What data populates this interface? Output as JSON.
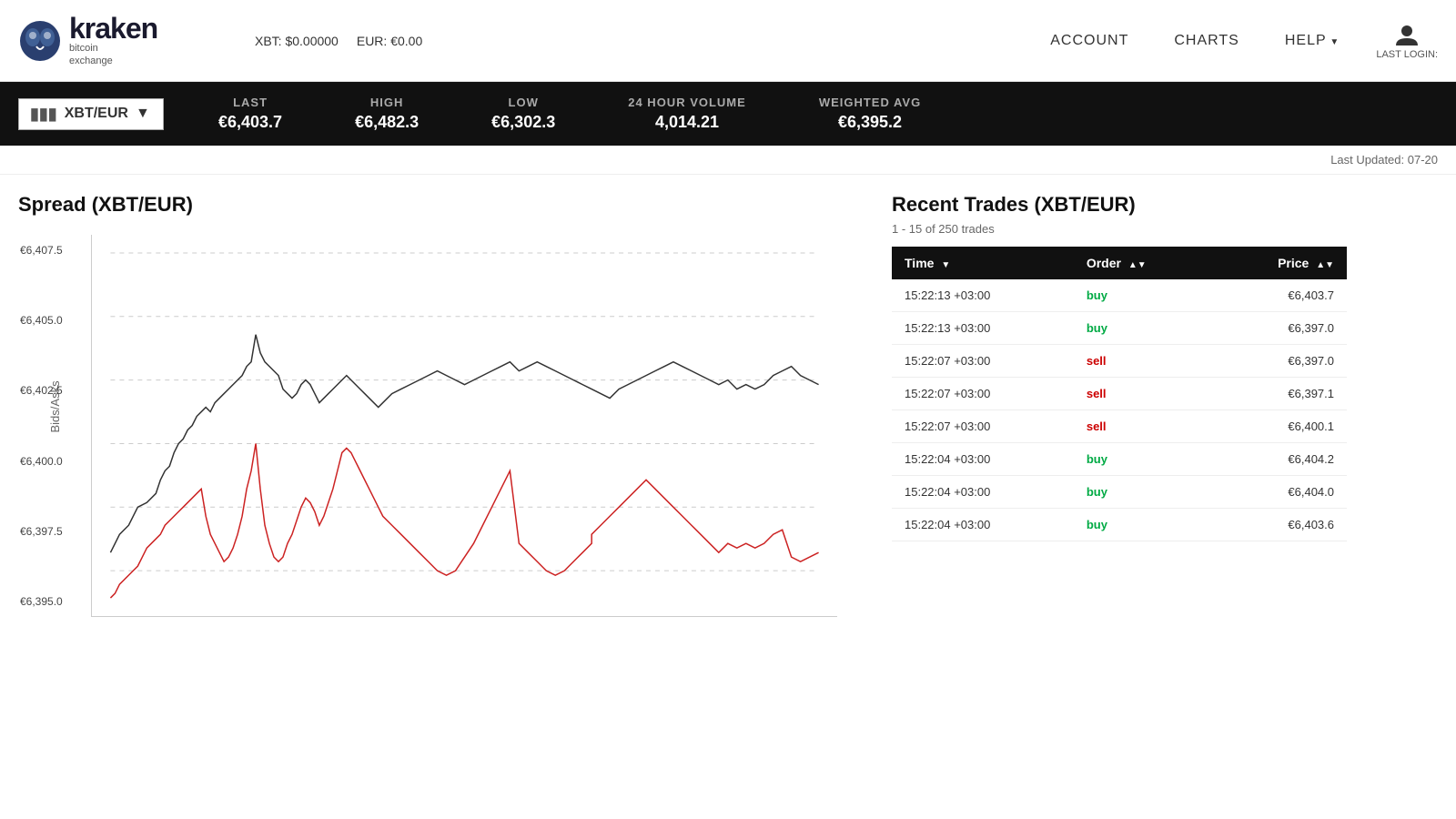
{
  "header": {
    "logo_name": "kraken",
    "logo_sub_line1": "bitcoin",
    "logo_sub_line2": "exchange",
    "xbt_balance": "XBT: $0.00000",
    "eur_balance": "EUR: €0.00",
    "nav_account": "ACCOUNT",
    "nav_charts": "CHARTS",
    "nav_help": "HELP",
    "user_label": "LAST LOGIN:"
  },
  "ticker": {
    "pair": "XBT/EUR",
    "last_label": "LAST",
    "last_value": "€6,403.7",
    "high_label": "HIGH",
    "high_value": "€6,482.3",
    "low_label": "LOW",
    "low_value": "€6,302.3",
    "volume_label": "24 HOUR VOLUME",
    "volume_value": "4,014.21",
    "wavg_label": "WEIGHTED AVG",
    "wavg_value": "€6,395.2"
  },
  "last_updated": "Last Updated: 07-20",
  "chart": {
    "title": "Spread (XBT/EUR)",
    "y_axis_label": "Bids/Asks",
    "y_ticks": [
      "€6,407.5",
      "€6,405.0",
      "€6,402.5",
      "€6,400.0",
      "€6,397.5",
      "€6,395.0"
    ]
  },
  "trades": {
    "title": "Recent Trades (XBT/EUR)",
    "subtitle": "1 - 15 of 250 trades",
    "columns": {
      "time": "Time",
      "order": "Order",
      "price": "Price"
    },
    "rows": [
      {
        "time": "15:22:13 +03:00",
        "order": "buy",
        "order_type": "buy",
        "price": "€6,403.7"
      },
      {
        "time": "15:22:13 +03:00",
        "order": "buy",
        "order_type": "buy",
        "price": "€6,397.0"
      },
      {
        "time": "15:22:07 +03:00",
        "order": "sell",
        "order_type": "sell",
        "price": "€6,397.0"
      },
      {
        "time": "15:22:07 +03:00",
        "order": "sell",
        "order_type": "sell",
        "price": "€6,397.1"
      },
      {
        "time": "15:22:07 +03:00",
        "order": "sell",
        "order_type": "sell",
        "price": "€6,400.1"
      },
      {
        "time": "15:22:04 +03:00",
        "order": "buy",
        "order_type": "buy",
        "price": "€6,404.2"
      },
      {
        "time": "15:22:04 +03:00",
        "order": "buy",
        "order_type": "buy",
        "price": "€6,404.0"
      },
      {
        "time": "15:22:04 +03:00",
        "order": "buy",
        "order_type": "buy",
        "price": "€6,403.6"
      }
    ]
  }
}
